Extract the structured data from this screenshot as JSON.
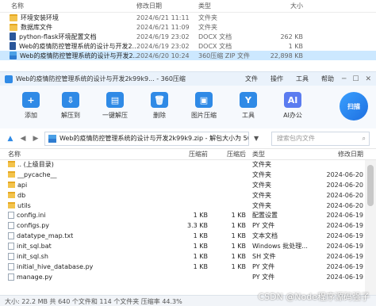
{
  "explorer": {
    "header": {
      "name": "名称",
      "date": "修改日期",
      "type": "类型",
      "size": "大小"
    },
    "rows": [
      {
        "name": "环境安装环境",
        "date": "2024/6/21 11:11",
        "type": "文件夹",
        "size": "",
        "icon": "folder"
      },
      {
        "name": "数据库文件",
        "date": "2024/6/21 11:09",
        "type": "文件夹",
        "size": "",
        "icon": "folder"
      },
      {
        "name": "python-flask环境配置文档",
        "date": "2024/6/19 23:02",
        "type": "DOCX 文档",
        "size": "262 KB",
        "icon": "docx"
      },
      {
        "name": "Web的疫情防控管理系统的设计与开发2...",
        "date": "2024/6/19 23:02",
        "type": "DOCX 文档",
        "size": "1 KB",
        "icon": "docx"
      },
      {
        "name": "Web的疫情防控管理系统的设计与开发2...",
        "date": "2024/6/20 10:24",
        "type": "360压缩 ZIP 文件",
        "size": "22,898 KB",
        "icon": "zip",
        "selected": true
      }
    ]
  },
  "window": {
    "title": "Web的疫情防控管理系统的设计与开发2k99k9... - 360压缩",
    "menu": [
      "文件",
      "操作",
      "工具",
      "帮助"
    ],
    "toolbar": [
      {
        "label": "添加",
        "icon": "add-icon",
        "color": "#2f8ae6",
        "glyph": "+"
      },
      {
        "label": "解压到",
        "icon": "extract-icon",
        "color": "#2f8ae6",
        "glyph": "⇩"
      },
      {
        "label": "一键解压",
        "icon": "one-click-extract-icon",
        "color": "#2f8ae6",
        "glyph": "▤"
      },
      {
        "label": "删除",
        "icon": "delete-icon",
        "color": "#2f8ae6",
        "glyph": "🗑"
      },
      {
        "label": "图片压缩",
        "icon": "image-compress-icon",
        "color": "#2f8ae6",
        "glyph": "▣"
      },
      {
        "label": "工具",
        "icon": "tools-icon",
        "color": "#2f8ae6",
        "glyph": "Y"
      },
      {
        "label": "AI办公",
        "icon": "ai-office-icon",
        "color": "#5b7cf0",
        "glyph": "AI"
      }
    ],
    "scan_label": "扫描",
    "address": "Web的疫情防控管理系统的设计与开发2k99k9.zip - 解包大小为 50.1",
    "search_placeholder": "搜索包内文件",
    "columns": {
      "name": "名称",
      "size": "压缩前",
      "packed": "压缩后",
      "type": "类型",
      "modified": "修改日期"
    },
    "files": [
      {
        "name": ".. (上级目录)",
        "size": "",
        "packed": "",
        "type": "文件夹",
        "modified": "",
        "kind": "folder"
      },
      {
        "name": "__pycache__",
        "size": "",
        "packed": "",
        "type": "文件夹",
        "modified": "2024-06-20",
        "kind": "folder"
      },
      {
        "name": "api",
        "size": "",
        "packed": "",
        "type": "文件夹",
        "modified": "2024-06-20",
        "kind": "folder"
      },
      {
        "name": "db",
        "size": "",
        "packed": "",
        "type": "文件夹",
        "modified": "2024-06-20",
        "kind": "folder"
      },
      {
        "name": "utils",
        "size": "",
        "packed": "",
        "type": "文件夹",
        "modified": "2024-06-20",
        "kind": "folder"
      },
      {
        "name": "config.ini",
        "size": "1 KB",
        "packed": "1 KB",
        "type": "配置设置",
        "modified": "2024-06-19",
        "kind": "file"
      },
      {
        "name": "configs.py",
        "size": "3.3 KB",
        "packed": "1 KB",
        "type": "PY 文件",
        "modified": "2024-06-19",
        "kind": "file"
      },
      {
        "name": "datatype_map.txt",
        "size": "1 KB",
        "packed": "1 KB",
        "type": "文本文档",
        "modified": "2024-06-19",
        "kind": "file"
      },
      {
        "name": "init_sql.bat",
        "size": "1 KB",
        "packed": "1 KB",
        "type": "Windows 批处理...",
        "modified": "2024-06-19",
        "kind": "file"
      },
      {
        "name": "init_sql.sh",
        "size": "1 KB",
        "packed": "1 KB",
        "type": "SH 文件",
        "modified": "2024-06-19",
        "kind": "file"
      },
      {
        "name": "initial_hive_database.py",
        "size": "1 KB",
        "packed": "1 KB",
        "type": "PY 文件",
        "modified": "2024-06-19",
        "kind": "file"
      },
      {
        "name": "manage.py",
        "size": "",
        "packed": "",
        "type": "PY 文件",
        "modified": "2024-06-19",
        "kind": "file"
      }
    ],
    "status": "大小: 22.2 MB 共 640 个文件和 114 个文件夹 压缩率 44.3%",
    "watermark": "CSDN @Node程序源码强子"
  }
}
